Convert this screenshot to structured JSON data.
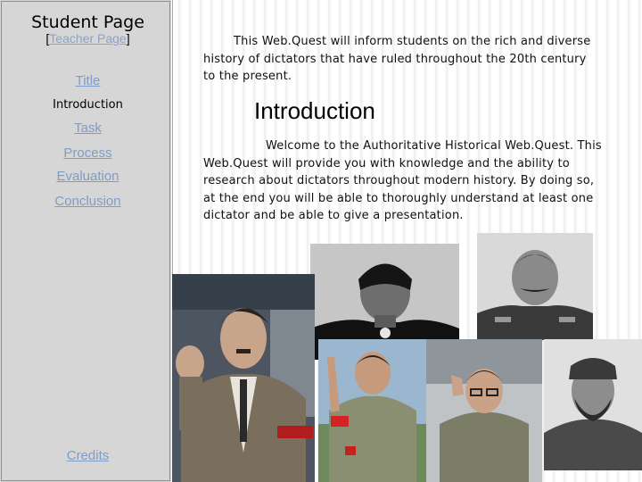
{
  "sidebar": {
    "title": "Student Page",
    "subtitle_open": "[",
    "subtitle_link": "Teacher Page",
    "subtitle_close": "]",
    "nav": [
      {
        "label": "Title",
        "current": false
      },
      {
        "label": "Introduction",
        "current": true
      },
      {
        "label": "Task",
        "current": false
      },
      {
        "label": "Process",
        "current": false
      },
      {
        "label": "Evaluation",
        "current": false
      },
      {
        "label": "Conclusion",
        "current": false
      }
    ],
    "credits": "Credits"
  },
  "main": {
    "intro_text": "This Web.Quest will inform students on the rich and diverse history of dictators that have ruled throughout the 20th century to the present.",
    "heading": "Introduction",
    "welcome_text": "Welcome to the Authoritative Historical Web.Quest. This Web.Quest will provide you with knowledge and the ability to research about dictators throughout modern history. By doing so, at the end you will be able to thoroughly understand at least one dictator and be able to give a presentation."
  },
  "colors": {
    "sidebar_bg": "#d6d6d6",
    "link": "#7f9cc6"
  }
}
